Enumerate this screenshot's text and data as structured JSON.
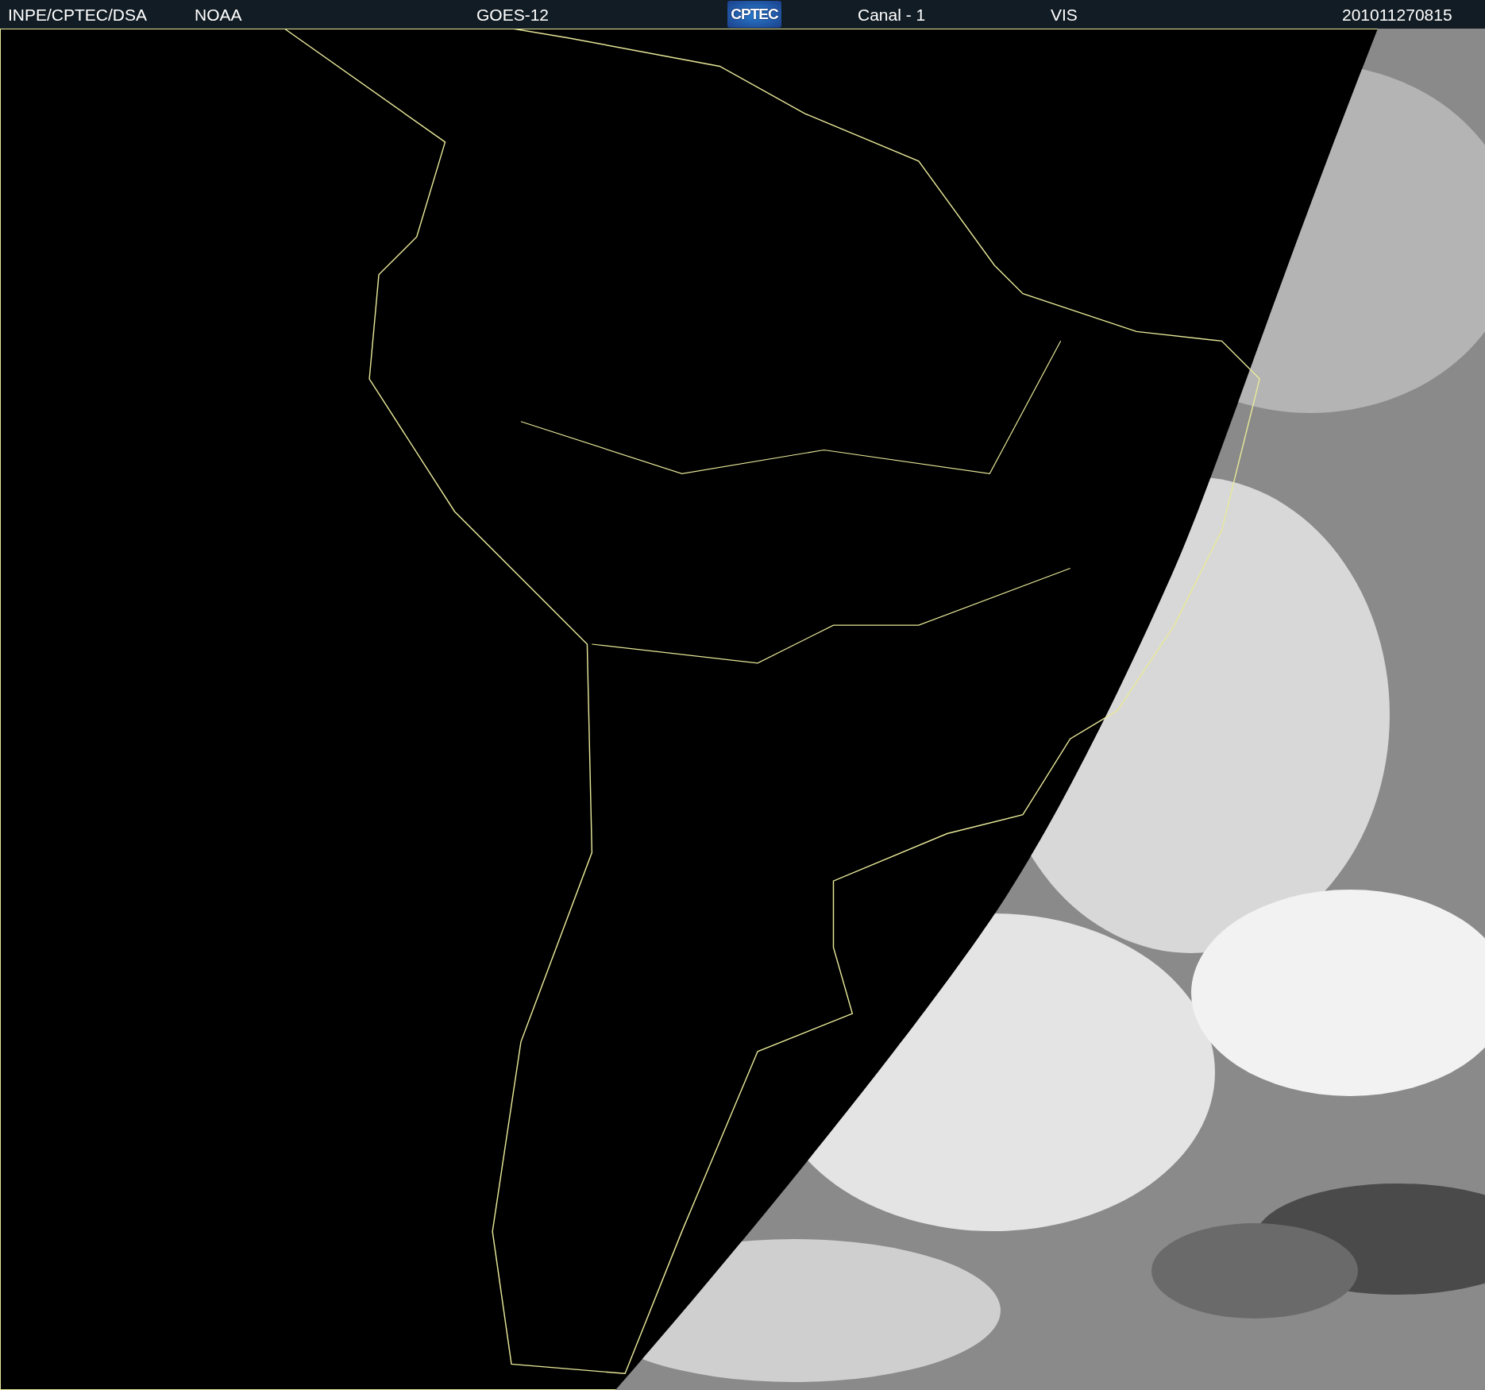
{
  "header": {
    "source": "INPE/CPTEC/DSA",
    "agency": "NOAA",
    "satellite": "GOES-12",
    "logo": "CPTEC",
    "channel": "Canal - 1",
    "band": "VIS",
    "timestamp": "201011270815"
  }
}
